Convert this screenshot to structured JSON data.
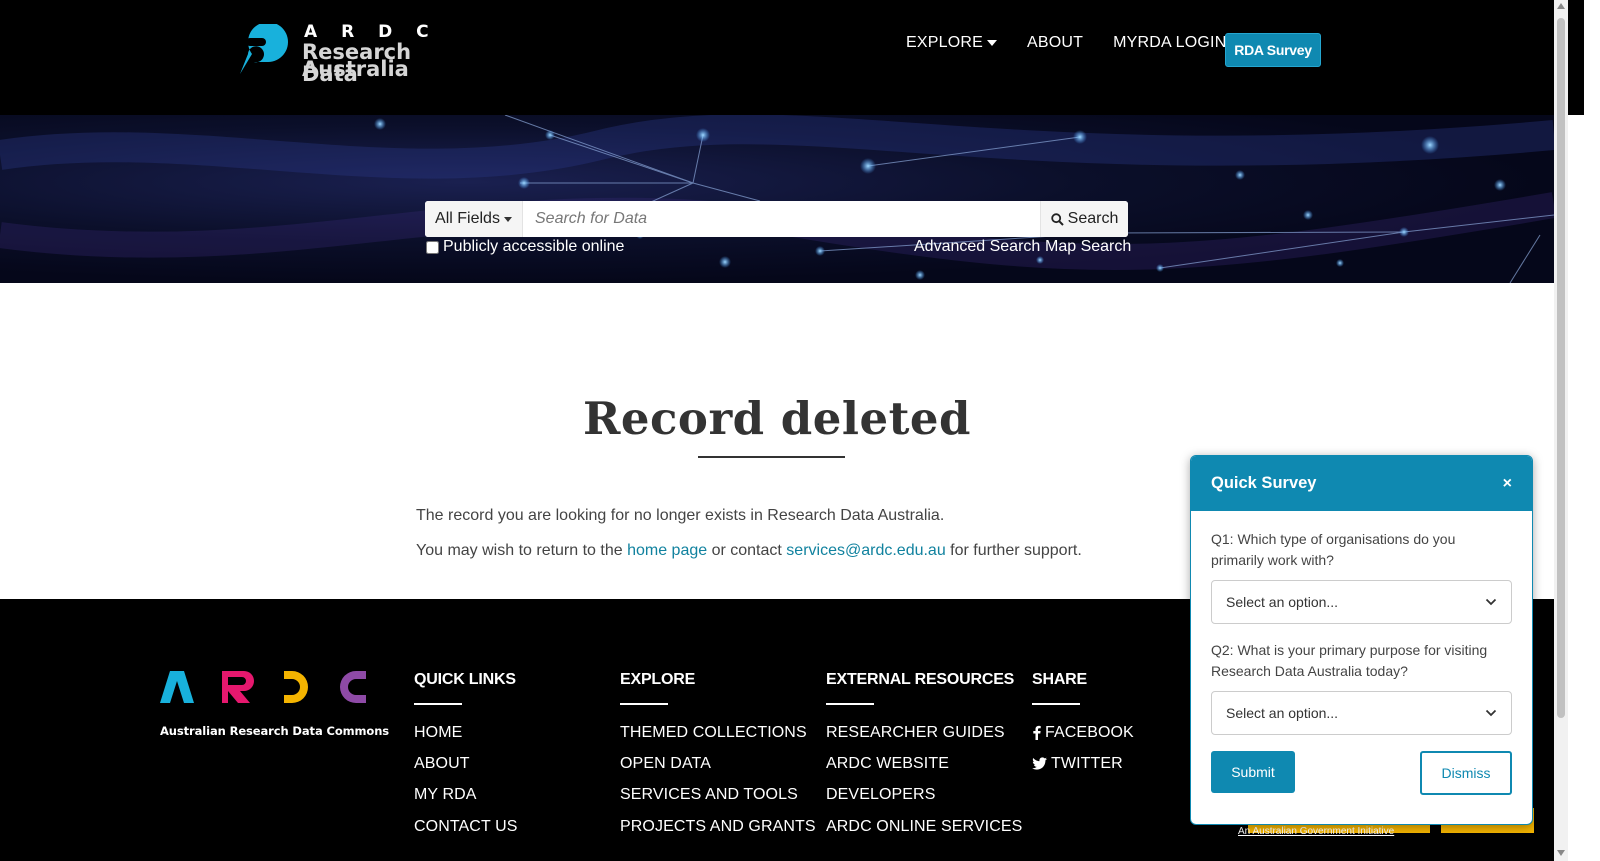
{
  "header": {
    "logo_ardc": "A R D C",
    "logo_line1": "Research Data",
    "logo_line2": "Australia",
    "nav": {
      "explore": "EXPLORE",
      "about": "ABOUT",
      "login": "MYRDA LOGIN"
    },
    "survey_button": "RDA Survey"
  },
  "search": {
    "field_select": "All Fields",
    "placeholder": "Search for Data",
    "button": "Search",
    "checkbox_label": "Publicly accessible online",
    "advanced": "Advanced Search",
    "map": "Map Search"
  },
  "main": {
    "title": "Record deleted",
    "paragraph1": "The record you are looking for no longer exists in Research Data Australia.",
    "p2_prefix": "You may wish to return to the ",
    "p2_home_link": "home page",
    "p2_middle": " or contact ",
    "p2_email": "services@ardc.edu.au",
    "p2_suffix": " for further support."
  },
  "footer": {
    "ardc_subtitle": "Australian Research Data Commons",
    "columns": [
      {
        "heading": "QUICK LINKS",
        "links": [
          "HOME",
          "ABOUT",
          "MY RDA",
          "CONTACT US"
        ]
      },
      {
        "heading": "EXPLORE",
        "links": [
          "THEMED COLLECTIONS",
          "OPEN DATA",
          "SERVICES AND TOOLS",
          "PROJECTS AND GRANTS"
        ]
      },
      {
        "heading": "EXTERNAL RESOURCES",
        "links": [
          "RESEARCHER GUIDES",
          "ARDC WEBSITE",
          "DEVELOPERS",
          "ARDC ONLINE SERVICES"
        ]
      },
      {
        "heading": "SHARE",
        "links": [
          "FACEBOOK",
          "TWITTER"
        ]
      }
    ],
    "gov_text": "An Australian Government Initiative"
  },
  "survey": {
    "title": "Quick Survey",
    "close": "×",
    "q1": "Q1: Which type of organisations do you primarily work with?",
    "q1_value": "Select an option...",
    "q2": "Q2: What is your primary purpose for visiting Research Data Australia today?",
    "q2_value": "Select an option...",
    "submit": "Submit",
    "dismiss": "Dismiss"
  },
  "colors": {
    "accent": "#0f89b1",
    "link": "#11829f",
    "ardc_a": "#18b1dc",
    "ardc_r": "#e6186e",
    "ardc_d": "#f4b400",
    "ardc_c": "#8e4aa6"
  }
}
